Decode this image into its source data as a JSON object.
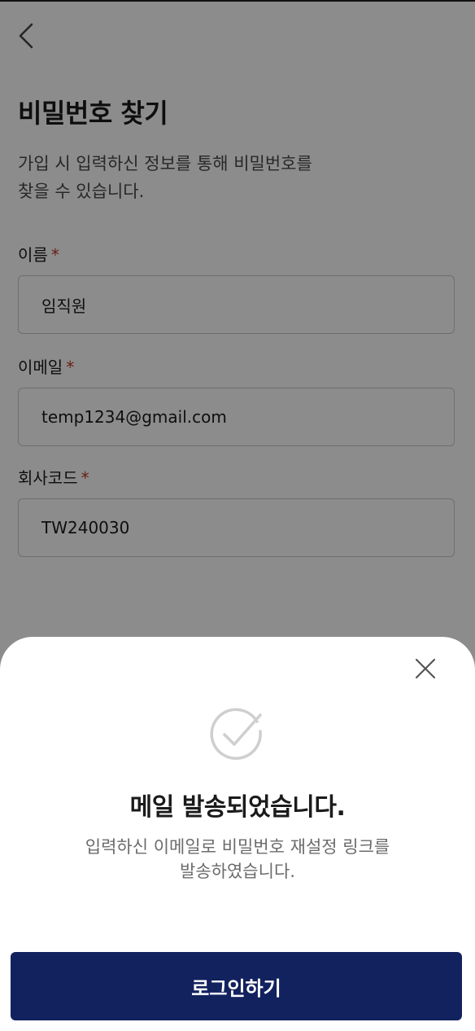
{
  "header": {
    "back_icon": "chevron-left-icon",
    "title": "비밀번호 찾기",
    "description": "가입 시 입력하신 정보를 통해 비밀번호를\n찾을 수 있습니다."
  },
  "form": {
    "required_mark": "*",
    "name_label": "이름",
    "name_value": "임직원",
    "email_label": "이메일",
    "email_value": "temp1234@gmail.com",
    "company_code_label": "회사코드",
    "company_code_value": "TW240030"
  },
  "modal": {
    "close_icon": "close-icon",
    "status_icon": "check-circle-icon",
    "title": "메일 발송되었습니다.",
    "description": "입력하신 이메일로 비밀번호 재설정 링크를\n발송하였습니다.",
    "primary_button": "로그인하기"
  },
  "colors": {
    "primary": "#12225e",
    "required": "#c0392b",
    "dim_overlay": "rgba(0,0,0,0.45)"
  }
}
